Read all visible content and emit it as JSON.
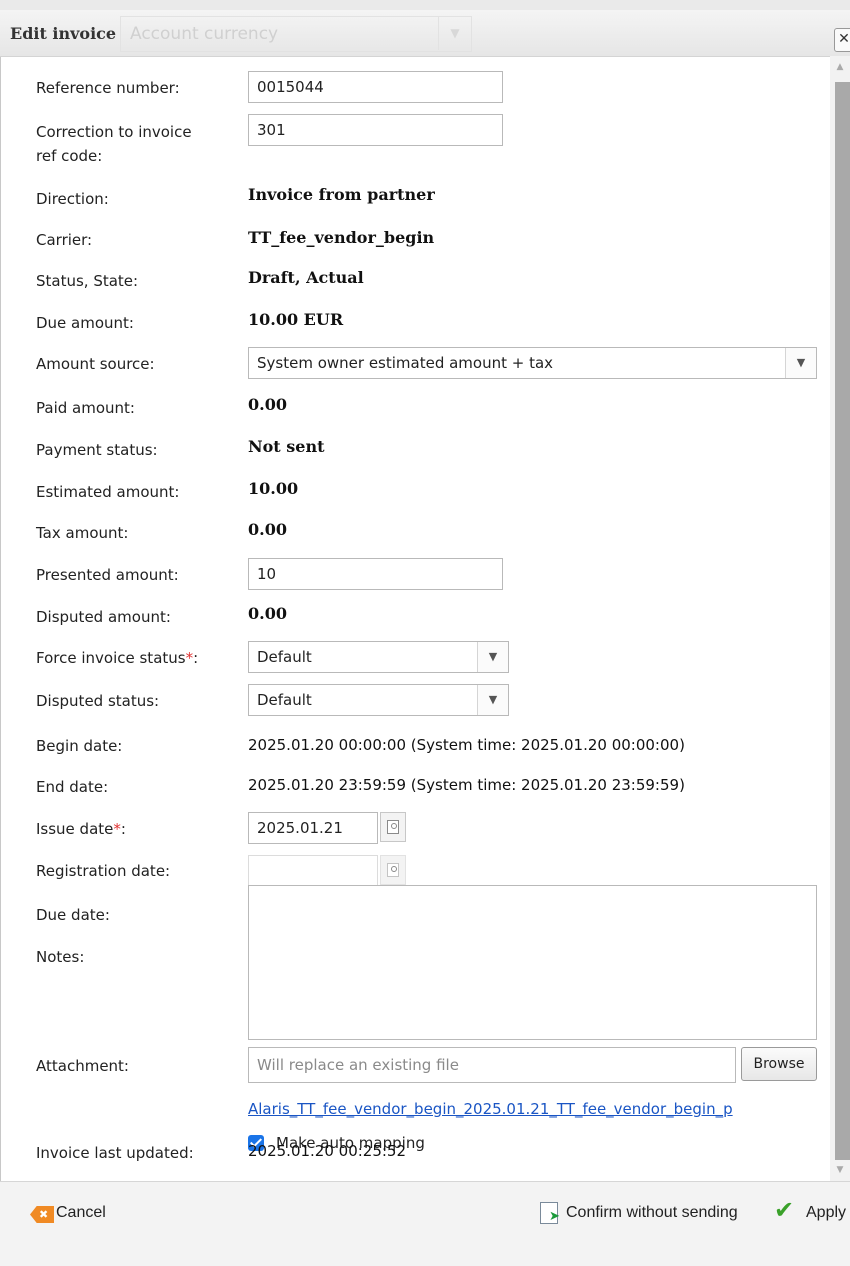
{
  "dialog": {
    "title": "Edit invoice",
    "background_hint": "Account currency",
    "close_glyph": "✕"
  },
  "fields": {
    "reference_number": {
      "label": "Reference number:",
      "value": "0015044"
    },
    "correction_ref": {
      "label_line1": "Correction to invoice",
      "label_line2": "ref code:",
      "value": "301"
    },
    "direction": {
      "label": "Direction:",
      "value": "Invoice from partner"
    },
    "carrier": {
      "label": "Carrier:",
      "value": "TT_fee_vendor_begin"
    },
    "status_state": {
      "label": "Status, State:",
      "value": "Draft, Actual"
    },
    "due_amount": {
      "label": "Due amount:",
      "value": "10.00 EUR"
    },
    "amount_source": {
      "label": "Amount source:",
      "value": "System owner estimated amount + tax"
    },
    "paid_amount": {
      "label": "Paid amount:",
      "value": "0.00"
    },
    "payment_status": {
      "label": "Payment status:",
      "value": "Not sent"
    },
    "estimated_amount": {
      "label": "Estimated amount:",
      "value": "10.00"
    },
    "tax_amount": {
      "label": "Tax amount:",
      "value": "0.00"
    },
    "presented_amount": {
      "label": "Presented amount:",
      "value": "10"
    },
    "disputed_amount": {
      "label": "Disputed amount:",
      "value": "0.00"
    },
    "force_invoice_status": {
      "label": "Force invoice status",
      "required_mark": "*",
      "colon": ":",
      "value": "Default"
    },
    "disputed_status": {
      "label": "Disputed status:",
      "value": "Default"
    },
    "begin_date": {
      "label": "Begin date:",
      "value": "2025.01.20 00:00:00 (System time: 2025.01.20 00:00:00)"
    },
    "end_date": {
      "label": "End date:",
      "value": "2025.01.20 23:59:59 (System time: 2025.01.20 23:59:59)"
    },
    "issue_date": {
      "label": "Issue date",
      "required_mark": "*",
      "colon": ":",
      "value": "2025.01.21"
    },
    "registration_date": {
      "label": "Registration date:",
      "value": ""
    },
    "due_date": {
      "label": "Due date:"
    },
    "notes": {
      "label": "Notes:",
      "value": ""
    },
    "attachment": {
      "label": "Attachment:",
      "placeholder": "Will replace an existing file",
      "browse_label": "Browse",
      "file_link": "Alaris_TT_fee_vendor_begin_2025.01.21_TT_fee_vendor_begin_p",
      "auto_mapping_label": "Make auto mapping",
      "auto_mapping_checked": true
    },
    "invoice_last_updated": {
      "label": "Invoice last updated:",
      "value": "2025.01.20 00:25:52"
    }
  },
  "footer": {
    "cancel_label": "Cancel",
    "confirm_label": "Confirm without sending",
    "apply_label": "Apply"
  },
  "colors": {
    "required": "#e03030",
    "link": "#1a55c4",
    "checkbox": "#1a74e8",
    "cancel_icon": "#f08a24",
    "apply_icon": "#3aa12a"
  }
}
